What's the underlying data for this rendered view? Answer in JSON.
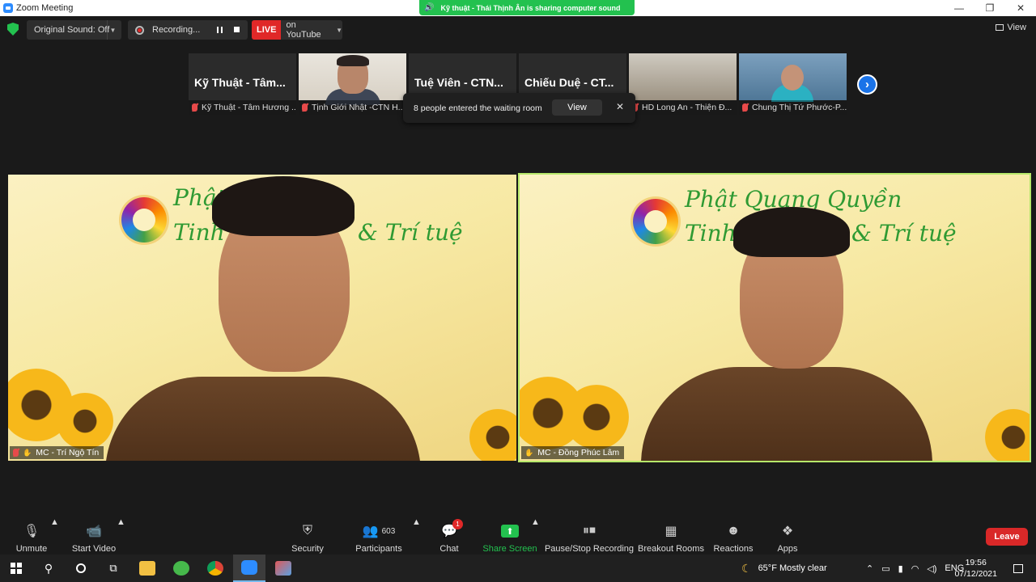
{
  "window": {
    "title": "Zoom Meeting"
  },
  "share_banner": {
    "text": "Kỹ thuật - Thái Thịnh Ân is sharing computer sound"
  },
  "topbar": {
    "original_sound": "Original Sound: Off",
    "recording": "Recording...",
    "live_badge": "LIVE",
    "live_target": "on YouTube",
    "view": "View"
  },
  "thumbnails": [
    {
      "big_name": "Kỹ Thuật - Tâm...",
      "caption": "Kỹ Thuật - Tâm Hương ..."
    },
    {
      "big_name": "",
      "caption": "Tịnh Giới Nhật -CTN H..."
    },
    {
      "big_name": "Tuệ Viên - CTN...",
      "caption": ""
    },
    {
      "big_name": "Chiếu Duệ - CT...",
      "caption": ""
    },
    {
      "big_name": "",
      "caption": "HD Long An - Thiện Đ..."
    },
    {
      "big_name": "",
      "caption": "Chung Thị Tứ Phước-P..."
    }
  ],
  "toast": {
    "message": "8 people entered the waiting room",
    "view": "View"
  },
  "videos": {
    "left": {
      "name": "MC - Trí Ngộ Tín",
      "bg_line1": "Phật",
      "bg_line1b": "ền",
      "bg_line2": "Tinh",
      "bg_line2b": "& Trí tuệ"
    },
    "right": {
      "name": "MC - Đồng Phúc Lâm",
      "bg_line1": "Phật Quang Quyền",
      "bg_line2": "Tinh h",
      "bg_line2b": "& Trí tuệ"
    }
  },
  "toolbar": {
    "unmute": "Unmute",
    "start_video": "Start Video",
    "security": "Security",
    "participants": "Participants",
    "participants_count": "603",
    "chat": "Chat",
    "chat_badge": "1",
    "share_screen": "Share Screen",
    "recording": "Pause/Stop Recording",
    "breakout": "Breakout Rooms",
    "reactions": "Reactions",
    "apps": "Apps",
    "leave": "Leave"
  },
  "taskbar": {
    "weather": "65°F  Mostly clear",
    "lang": "ENG",
    "time": "19:56",
    "date": "07/12/2021"
  },
  "colors": {
    "live_red": "#e02828",
    "share_green": "#23c14f",
    "active_border": "#b6e86a",
    "leave_red": "#d92828"
  }
}
